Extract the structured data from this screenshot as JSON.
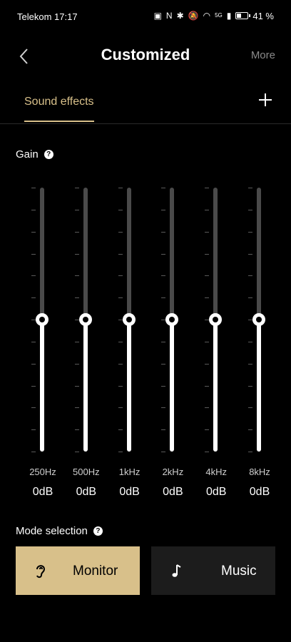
{
  "status_bar": {
    "carrier": "Telekom",
    "time": "17:17",
    "battery": "41 %",
    "battery_level": 0.41,
    "signal_label": "5G"
  },
  "header": {
    "title": "Customized",
    "more_label": "More"
  },
  "tabs": {
    "active_label": "Sound effects"
  },
  "gain": {
    "label": "Gain"
  },
  "equalizer": {
    "bands": [
      {
        "freq": "250Hz",
        "value": "0dB",
        "level": 0.5
      },
      {
        "freq": "500Hz",
        "value": "0dB",
        "level": 0.5
      },
      {
        "freq": "1kHz",
        "value": "0dB",
        "level": 0.5
      },
      {
        "freq": "2kHz",
        "value": "0dB",
        "level": 0.5
      },
      {
        "freq": "4kHz",
        "value": "0dB",
        "level": 0.5
      },
      {
        "freq": "8kHz",
        "value": "0dB",
        "level": 0.5
      }
    ]
  },
  "mode": {
    "label": "Mode selection",
    "options": [
      {
        "label": "Monitor",
        "icon": "ear-icon",
        "selected": true
      },
      {
        "label": "Music",
        "icon": "music-note-icon",
        "selected": false
      }
    ]
  },
  "colors": {
    "accent": "#d8c08a",
    "background": "#000000",
    "inactive_button": "#1c1c1c"
  }
}
